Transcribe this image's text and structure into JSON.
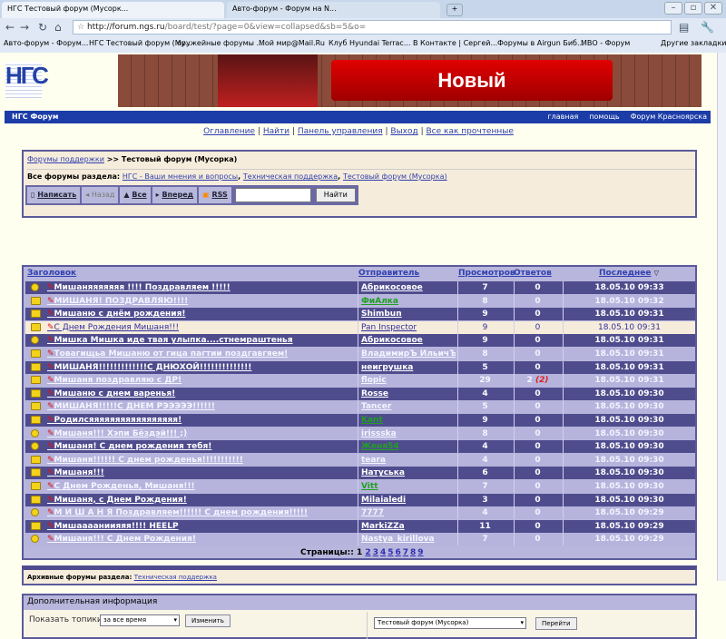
{
  "browser": {
    "tabs": [
      "НГС Тестовый форум (Мусорк...",
      "Авто-форум - Форум на N..."
    ],
    "url_host": "http://forum.ngs.ru",
    "url_path": "/board/test/?page=0&view=collapsed&sb=5&o=",
    "bookmarks": [
      "Авто-форум - Форум...",
      "НГС Тестовый форум (Му...",
      "оружейные форумы ...",
      "Мой мир@Mail.Ru",
      "Клуб Hyundai Terrac...",
      "В Контакте | Сергей...",
      "Форумы в Airgun Биб...",
      "МВО - Форум",
      "Другие закладки"
    ]
  },
  "logo": "НГС",
  "banner_text": "Новый",
  "header": {
    "title": "НГС Форум",
    "links": [
      "главная",
      "помощь",
      "Форум Красноярска"
    ]
  },
  "toplinks": [
    "Оглавление",
    "Найти",
    "Панель управления",
    "Выход",
    "Все как прочтенные"
  ],
  "breadcrumb": {
    "link": "Форумы поддержки",
    "current": ">> Тестовый форум (Мусорка)"
  },
  "section": {
    "label": "Все форумы раздела:",
    "forums": [
      "НГС - Ваши мнения и вопросы",
      "Техническая поддержка",
      "Тестовый форум (Мусорка)"
    ]
  },
  "toolbar": {
    "write": "Написать",
    "back": "Назад",
    "all": "Все",
    "forward": "Вперед",
    "rss": "RSS",
    "search_value": "",
    "search_button": "Найти"
  },
  "columns": {
    "title": "Заголовок",
    "sender": "Отправитель",
    "views": "Просмотров",
    "replies": "Ответов",
    "last": "Последнее"
  },
  "topics": [
    {
      "title": "Мишаняяяяяяя !!!! Поздравляем !!!!!",
      "sender": "Абрикосовое",
      "views": "7",
      "replies": "0",
      "last": "18.05.10 09:33",
      "icon": "smiley"
    },
    {
      "title": "МИШАНЯ! ПОЗДРАВЛЯЮ!!!!",
      "sender": "ФиАлка",
      "views": "8",
      "replies": "0",
      "last": "18.05.10 09:32",
      "icon": "book",
      "green": true
    },
    {
      "title": "Мишаню с днём рождения!",
      "sender": "Shimbun",
      "views": "9",
      "replies": "0",
      "last": "18.05.10 09:31",
      "icon": "book"
    },
    {
      "title": "С Днем Рождения Мишаня!!!",
      "sender": "Pan Inspector",
      "views": "9",
      "replies": "0",
      "last": "18.05.10 09:31",
      "icon": "trophy"
    },
    {
      "title": "Мишка Мишка иде твая улыпка....стнемраштенья",
      "sender": "Абрикосовое",
      "views": "9",
      "replies": "0",
      "last": "18.05.10 09:31",
      "icon": "bulb"
    },
    {
      "title": "Товагищьа Мишаню от гица пагтии поздгавгяем!",
      "sender": "ВладимирЪ ИльичЪ",
      "views": "8",
      "replies": "0",
      "last": "18.05.10 09:31",
      "icon": "book"
    },
    {
      "title": "МИШАНЯ!!!!!!!!!!!!!С ДНЮХОЙ!!!!!!!!!!!!!!",
      "sender": "неигрушка",
      "views": "5",
      "replies": "0",
      "last": "18.05.10 09:31",
      "icon": "exclaim"
    },
    {
      "title": "Мишаня поздравляю с ДР!",
      "sender": "flopic",
      "views": "29",
      "replies": "2",
      "new_replies": "(2)",
      "last": "18.05.10 09:31",
      "icon": "book"
    },
    {
      "title": "Мишаню с днем варенья!",
      "sender": "Rosse",
      "views": "4",
      "replies": "0",
      "last": "18.05.10 09:30",
      "icon": "book"
    },
    {
      "title": "МИШАНЯ!!!!!С ДНЕМ РЭЭЭЭЭ!!!!!!",
      "sender": "Tancer",
      "views": "5",
      "replies": "0",
      "last": "18.05.10 09:30",
      "icon": "book"
    },
    {
      "title": "Родилсяяяяяяяяяяяяяяяяя!",
      "sender": "Kant",
      "views": "9",
      "replies": "0",
      "last": "18.05.10 09:30",
      "icon": "book",
      "green": true
    },
    {
      "title": "Мишаня!!! Хэпи Бёздэй!!! ;)",
      "sender": "irissska",
      "views": "8",
      "replies": "0",
      "last": "18.05.10 09:30",
      "icon": "smiley"
    },
    {
      "title": "Мишаня! С днем рождения тебя!",
      "sender": "Женя54",
      "views": "4",
      "replies": "0",
      "last": "18.05.10 09:30",
      "icon": "smiley",
      "green": true
    },
    {
      "title": "Мишаня!!!!!! С днем рожденья!!!!!!!!!!!",
      "sender": "teara",
      "views": "4",
      "replies": "0",
      "last": "18.05.10 09:30",
      "icon": "book"
    },
    {
      "title": "Мишаня!!!",
      "sender": "Натуська",
      "views": "6",
      "replies": "0",
      "last": "18.05.10 09:30",
      "icon": "book"
    },
    {
      "title": "С Днем Рожденья, Мишаня!!!",
      "sender": "Vitt",
      "views": "7",
      "replies": "0",
      "last": "18.05.10 09:30",
      "icon": "book",
      "green": true
    },
    {
      "title": "Мишаня, с Днем Рождения!",
      "sender": "Milaialedi",
      "views": "3",
      "replies": "0",
      "last": "18.05.10 09:30",
      "icon": "book"
    },
    {
      "title": "М И Ш А Н Я Поздравляем!!!!!! С днем рождения!!!!!",
      "sender": "7777",
      "views": "4",
      "replies": "0",
      "last": "18.05.10 09:29",
      "icon": "smiley"
    },
    {
      "title": "Мишааааниияяя!!!! HEELP",
      "sender": "MarkiZZa",
      "views": "11",
      "replies": "0",
      "last": "18.05.10 09:29",
      "icon": "book"
    },
    {
      "title": "Мишаня!!! С Днем Рождения!",
      "sender": "Nastya_kirillova",
      "views": "7",
      "replies": "0",
      "last": "18.05.10 09:29",
      "icon": "smiley"
    }
  ],
  "pagination": {
    "label": "Страницы::",
    "current": "1",
    "pages": [
      "2",
      "3",
      "4",
      "5",
      "6",
      "7",
      "8",
      "9"
    ]
  },
  "archive": {
    "label": "Архивные форумы раздела:",
    "link": "Техническая поддержка"
  },
  "extra": {
    "title": "Дополнительная информация",
    "show_label": "Показать топики",
    "period": "за все время",
    "change": "Изменить",
    "forum": "Тестовый форум (Мусорка)",
    "go": "Перейти"
  }
}
